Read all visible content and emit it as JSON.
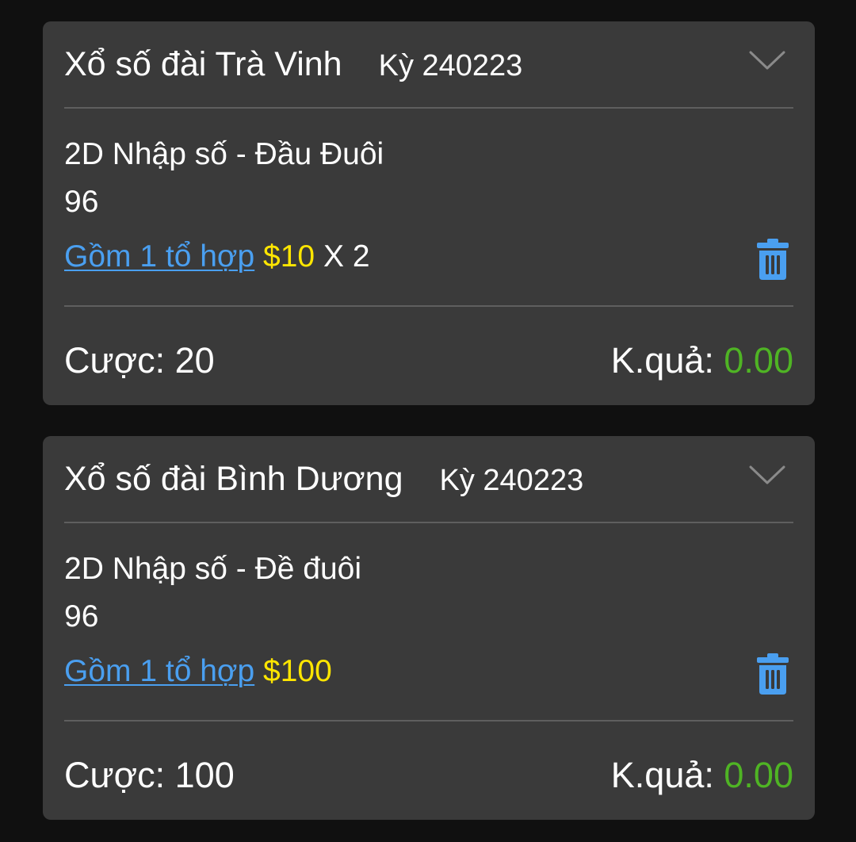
{
  "colors": {
    "background": "#101010",
    "card": "#3a3a3a",
    "link": "#4a9ff0",
    "amount": "#ffe600",
    "result": "#4fb424",
    "trash": "#4a9ff0"
  },
  "cards": [
    {
      "title": "Xổ số đài Trà Vinh",
      "period": "Kỳ 240223",
      "expand_icon": "chevron-down-icon",
      "bet_type": "2D Nhập số - Đầu Đuôi",
      "numbers": "96",
      "combo_link": "Gồm 1 tổ hợp",
      "amount": "$10",
      "multiplier": "X 2",
      "delete_icon": "trash-icon",
      "stake_label": "Cược:",
      "stake_value": "20",
      "result_label": "K.quả:",
      "result_value": "0.00"
    },
    {
      "title": "Xổ số đài Bình Dương",
      "period": "Kỳ 240223",
      "expand_icon": "chevron-down-icon",
      "bet_type": "2D Nhập số - Đề đuôi",
      "numbers": "96",
      "combo_link": "Gồm 1 tổ hợp",
      "amount": "$100",
      "multiplier": "",
      "delete_icon": "trash-icon",
      "stake_label": "Cược:",
      "stake_value": "100",
      "result_label": "K.quả:",
      "result_value": "0.00"
    }
  ]
}
